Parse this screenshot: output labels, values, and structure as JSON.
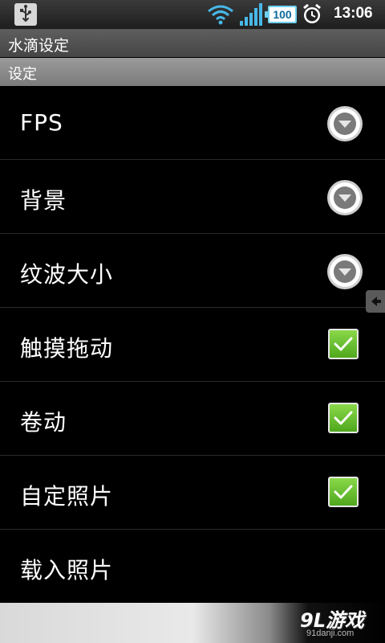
{
  "status_bar": {
    "time": "13:06",
    "battery": "100",
    "icons": [
      "usb-icon",
      "wifi-icon",
      "signal-icon",
      "battery-icon",
      "alarm-icon"
    ]
  },
  "title_bar": {
    "title": "水滴设定"
  },
  "section": {
    "header": "设定"
  },
  "settings": {
    "items": [
      {
        "label": "FPS",
        "control": "dropdown"
      },
      {
        "label": "背景",
        "control": "dropdown"
      },
      {
        "label": "纹波大小",
        "control": "dropdown"
      },
      {
        "label": "触摸拖动",
        "control": "checkbox",
        "checked": true
      },
      {
        "label": "卷动",
        "control": "checkbox",
        "checked": true
      },
      {
        "label": "自定照片",
        "control": "checkbox",
        "checked": true
      },
      {
        "label": "载入照片",
        "control": "none"
      }
    ]
  },
  "watermark": {
    "logo": "9L游戏",
    "url": "91danji.com"
  },
  "colors": {
    "checkbox_green": "#5cb82a",
    "battery_blue": "#6fd0f0",
    "background": "#000000"
  }
}
